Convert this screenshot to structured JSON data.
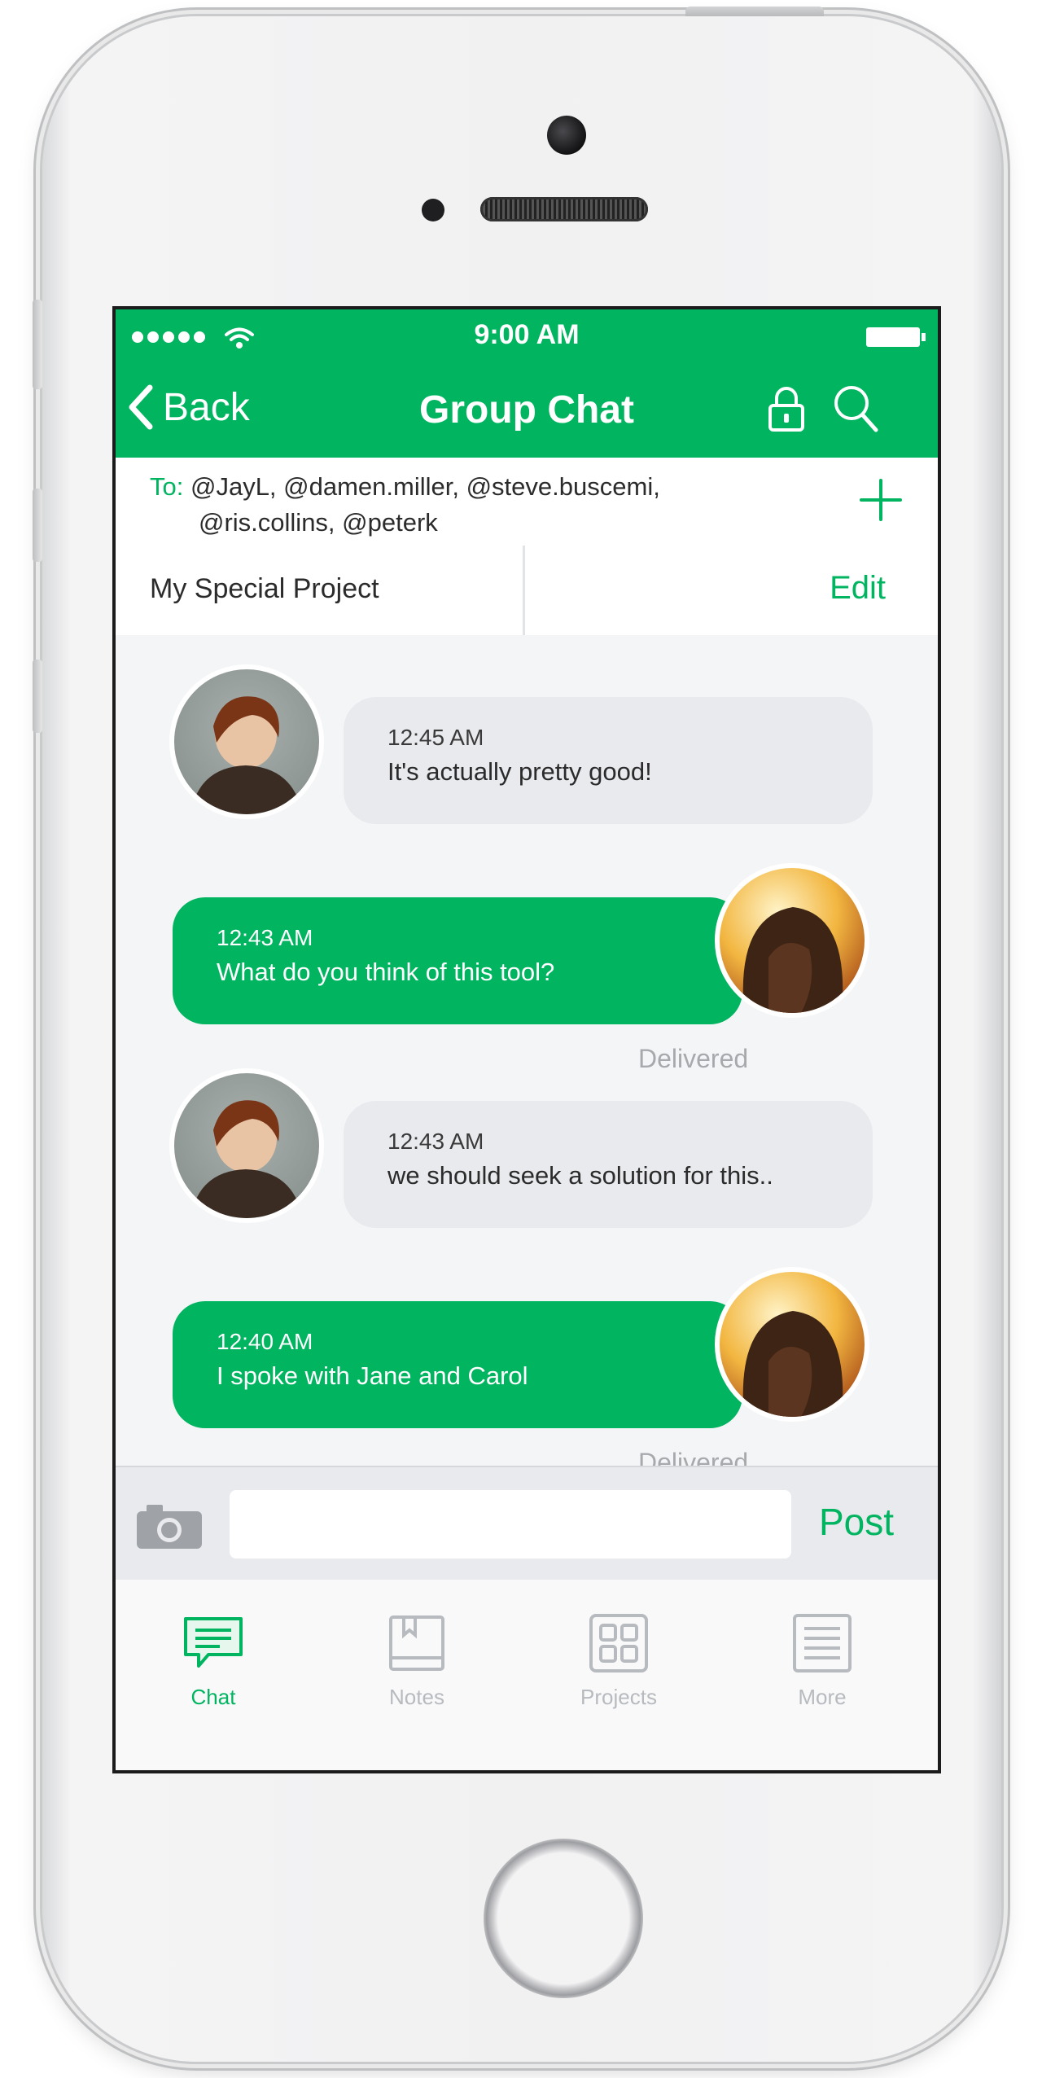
{
  "status_bar": {
    "time": "9:00 AM"
  },
  "nav": {
    "back_label": "Back",
    "title": "Group Chat"
  },
  "recipients": {
    "label": "To:",
    "line1": "@JayL, @damen.miller, @steve.buscemi,",
    "line2": "@ris.collins, @peterk"
  },
  "project": {
    "name": "My Special Project",
    "edit_label": "Edit"
  },
  "messages": [
    {
      "direction": "incoming",
      "time": "12:45 AM",
      "text": "It's actually pretty good!"
    },
    {
      "direction": "outgoing",
      "time": "12:43 AM",
      "text": "What do you think of this tool?",
      "status": "Delivered"
    },
    {
      "direction": "incoming",
      "time": "12:43 AM",
      "text": "we should seek a solution for this.."
    },
    {
      "direction": "outgoing",
      "time": "12:40 AM",
      "text": "I spoke with Jane and Carol",
      "status": "Delivered"
    }
  ],
  "composer": {
    "placeholder": "",
    "post_label": "Post"
  },
  "tabs": [
    {
      "label": "Chat",
      "icon": "chat-icon",
      "active": true
    },
    {
      "label": "Notes",
      "icon": "notes-icon",
      "active": false
    },
    {
      "label": "Projects",
      "icon": "projects-icon",
      "active": false
    },
    {
      "label": "More",
      "icon": "more-icon",
      "active": false
    }
  ],
  "colors": {
    "accent": "#00b460",
    "incoming_bubble": "#e9eaee",
    "inactive_tab": "#b7babe"
  }
}
